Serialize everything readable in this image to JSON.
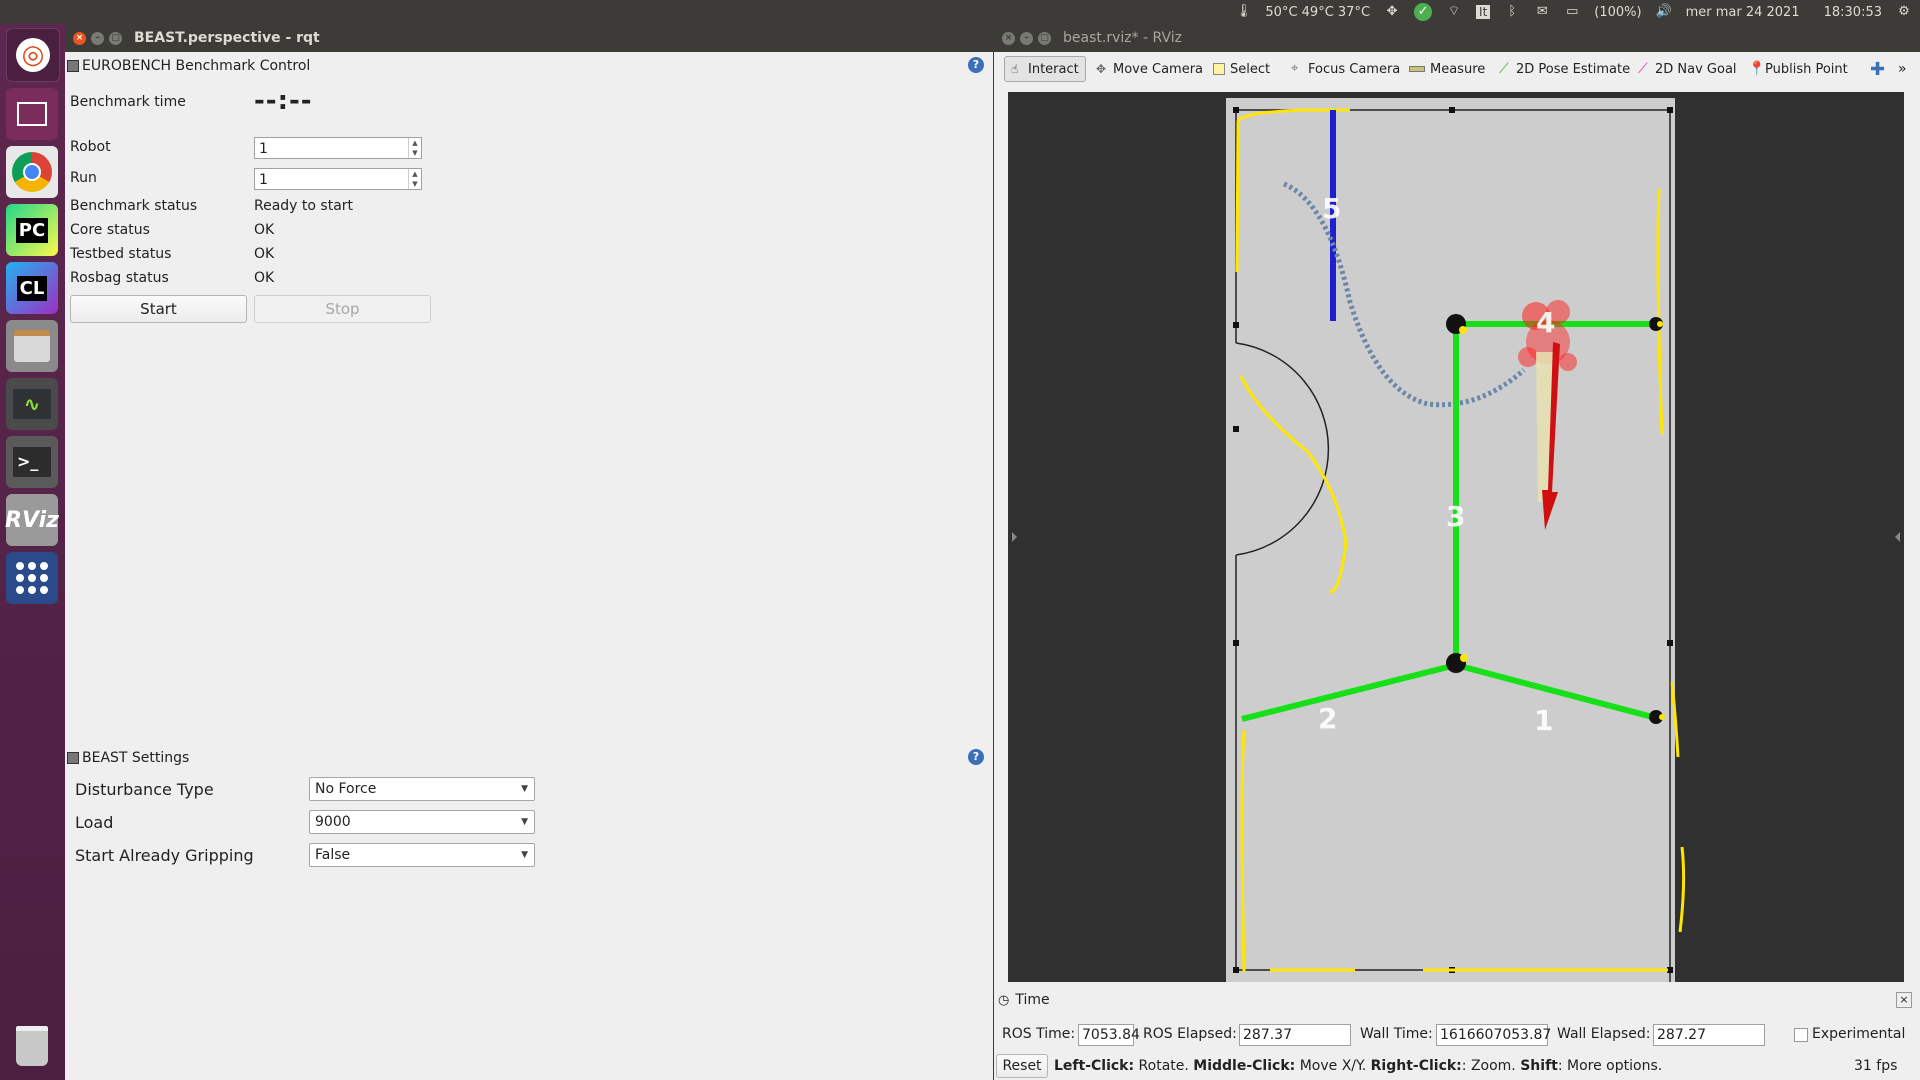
{
  "panel": {
    "temps": "50°C 49°C 37°C",
    "keyboard": "It",
    "battery": "(100%)",
    "date": "mer mar 24 2021",
    "time": "18:30:53"
  },
  "launcher": {
    "items": [
      {
        "name": "ubuntu-dash",
        "glyph": "◎",
        "color": "#dd4814"
      },
      {
        "name": "workspace-switcher",
        "glyph": "▭",
        "color": "#5e2750"
      },
      {
        "name": "chrome",
        "glyph": "●",
        "color": "#4285f4"
      },
      {
        "name": "pycharm",
        "glyph": "PC",
        "color": "#21d789"
      },
      {
        "name": "clion",
        "glyph": "CL",
        "color": "#22b1ef"
      },
      {
        "name": "files",
        "glyph": "▤",
        "color": "#b9b9b9"
      },
      {
        "name": "system-monitor",
        "glyph": "∿",
        "color": "#2f3234"
      },
      {
        "name": "terminal",
        "glyph": ">_",
        "color": "#2c2c2c"
      },
      {
        "name": "rviz",
        "glyph": "RViz",
        "color": "#9a9a9a"
      },
      {
        "name": "app-grid",
        "glyph": "⠿",
        "color": "#3b5ea8"
      },
      {
        "name": "trash",
        "glyph": "🗑",
        "color": "#5a5a5a"
      }
    ]
  },
  "rqt": {
    "title": "BEAST.perspective - rqt",
    "benchmark": {
      "plugin_title": "EUROBENCH Benchmark Control",
      "time_label": "Benchmark time",
      "time_value": "--:--",
      "robot_label": "Robot",
      "robot_value": "1",
      "run_label": "Run",
      "run_value": "1",
      "status_rows": [
        {
          "label": "Benchmark status",
          "value": "Ready to start"
        },
        {
          "label": "Core status",
          "value": "OK"
        },
        {
          "label": "Testbed status",
          "value": "OK"
        },
        {
          "label": "Rosbag status",
          "value": "OK"
        }
      ],
      "start_label": "Start",
      "stop_label": "Stop"
    },
    "settings": {
      "plugin_title": "BEAST Settings",
      "rows": [
        {
          "label": "Disturbance Type",
          "value": "No Force"
        },
        {
          "label": "Load",
          "value": "9000"
        },
        {
          "label": "Start Already Gripping",
          "value": "False"
        }
      ]
    }
  },
  "rviz": {
    "title": "beast.rviz* - RViz",
    "tools": [
      {
        "label": "Interact",
        "icon": "hand-icon"
      },
      {
        "label": "Move Camera",
        "icon": "move-icon"
      },
      {
        "label": "Select",
        "icon": "select-icon"
      },
      {
        "label": "Focus Camera",
        "icon": "focus-icon"
      },
      {
        "label": "Measure",
        "icon": "ruler-icon"
      },
      {
        "label": "2D Pose Estimate",
        "icon": "pose-arrow-icon"
      },
      {
        "label": "2D Nav Goal",
        "icon": "nav-goal-icon"
      },
      {
        "label": "Publish Point",
        "icon": "pin-icon"
      }
    ],
    "map_labels": [
      "1",
      "2",
      "3",
      "4",
      "5"
    ],
    "time_panel": {
      "title": "Time",
      "ros_time_label": "ROS Time:",
      "ros_time": "7053.84",
      "ros_elapsed_label": "ROS Elapsed:",
      "ros_elapsed": "287.37",
      "wall_time_label": "Wall Time:",
      "wall_time": "1616607053.87",
      "wall_elapsed_label": "Wall Elapsed:",
      "wall_elapsed": "287.27",
      "experimental_label": "Experimental",
      "reset_label": "Reset",
      "hint_left_key": "Left-Click:",
      "hint_left": " Rotate. ",
      "hint_middle_key": "Middle-Click:",
      "hint_middle": " Move X/Y. ",
      "hint_right_key": "Right-Click:",
      "hint_right": ": Zoom. ",
      "hint_shift_key": "Shift",
      "hint_shift": ": More options.",
      "fps": "31 fps"
    }
  }
}
